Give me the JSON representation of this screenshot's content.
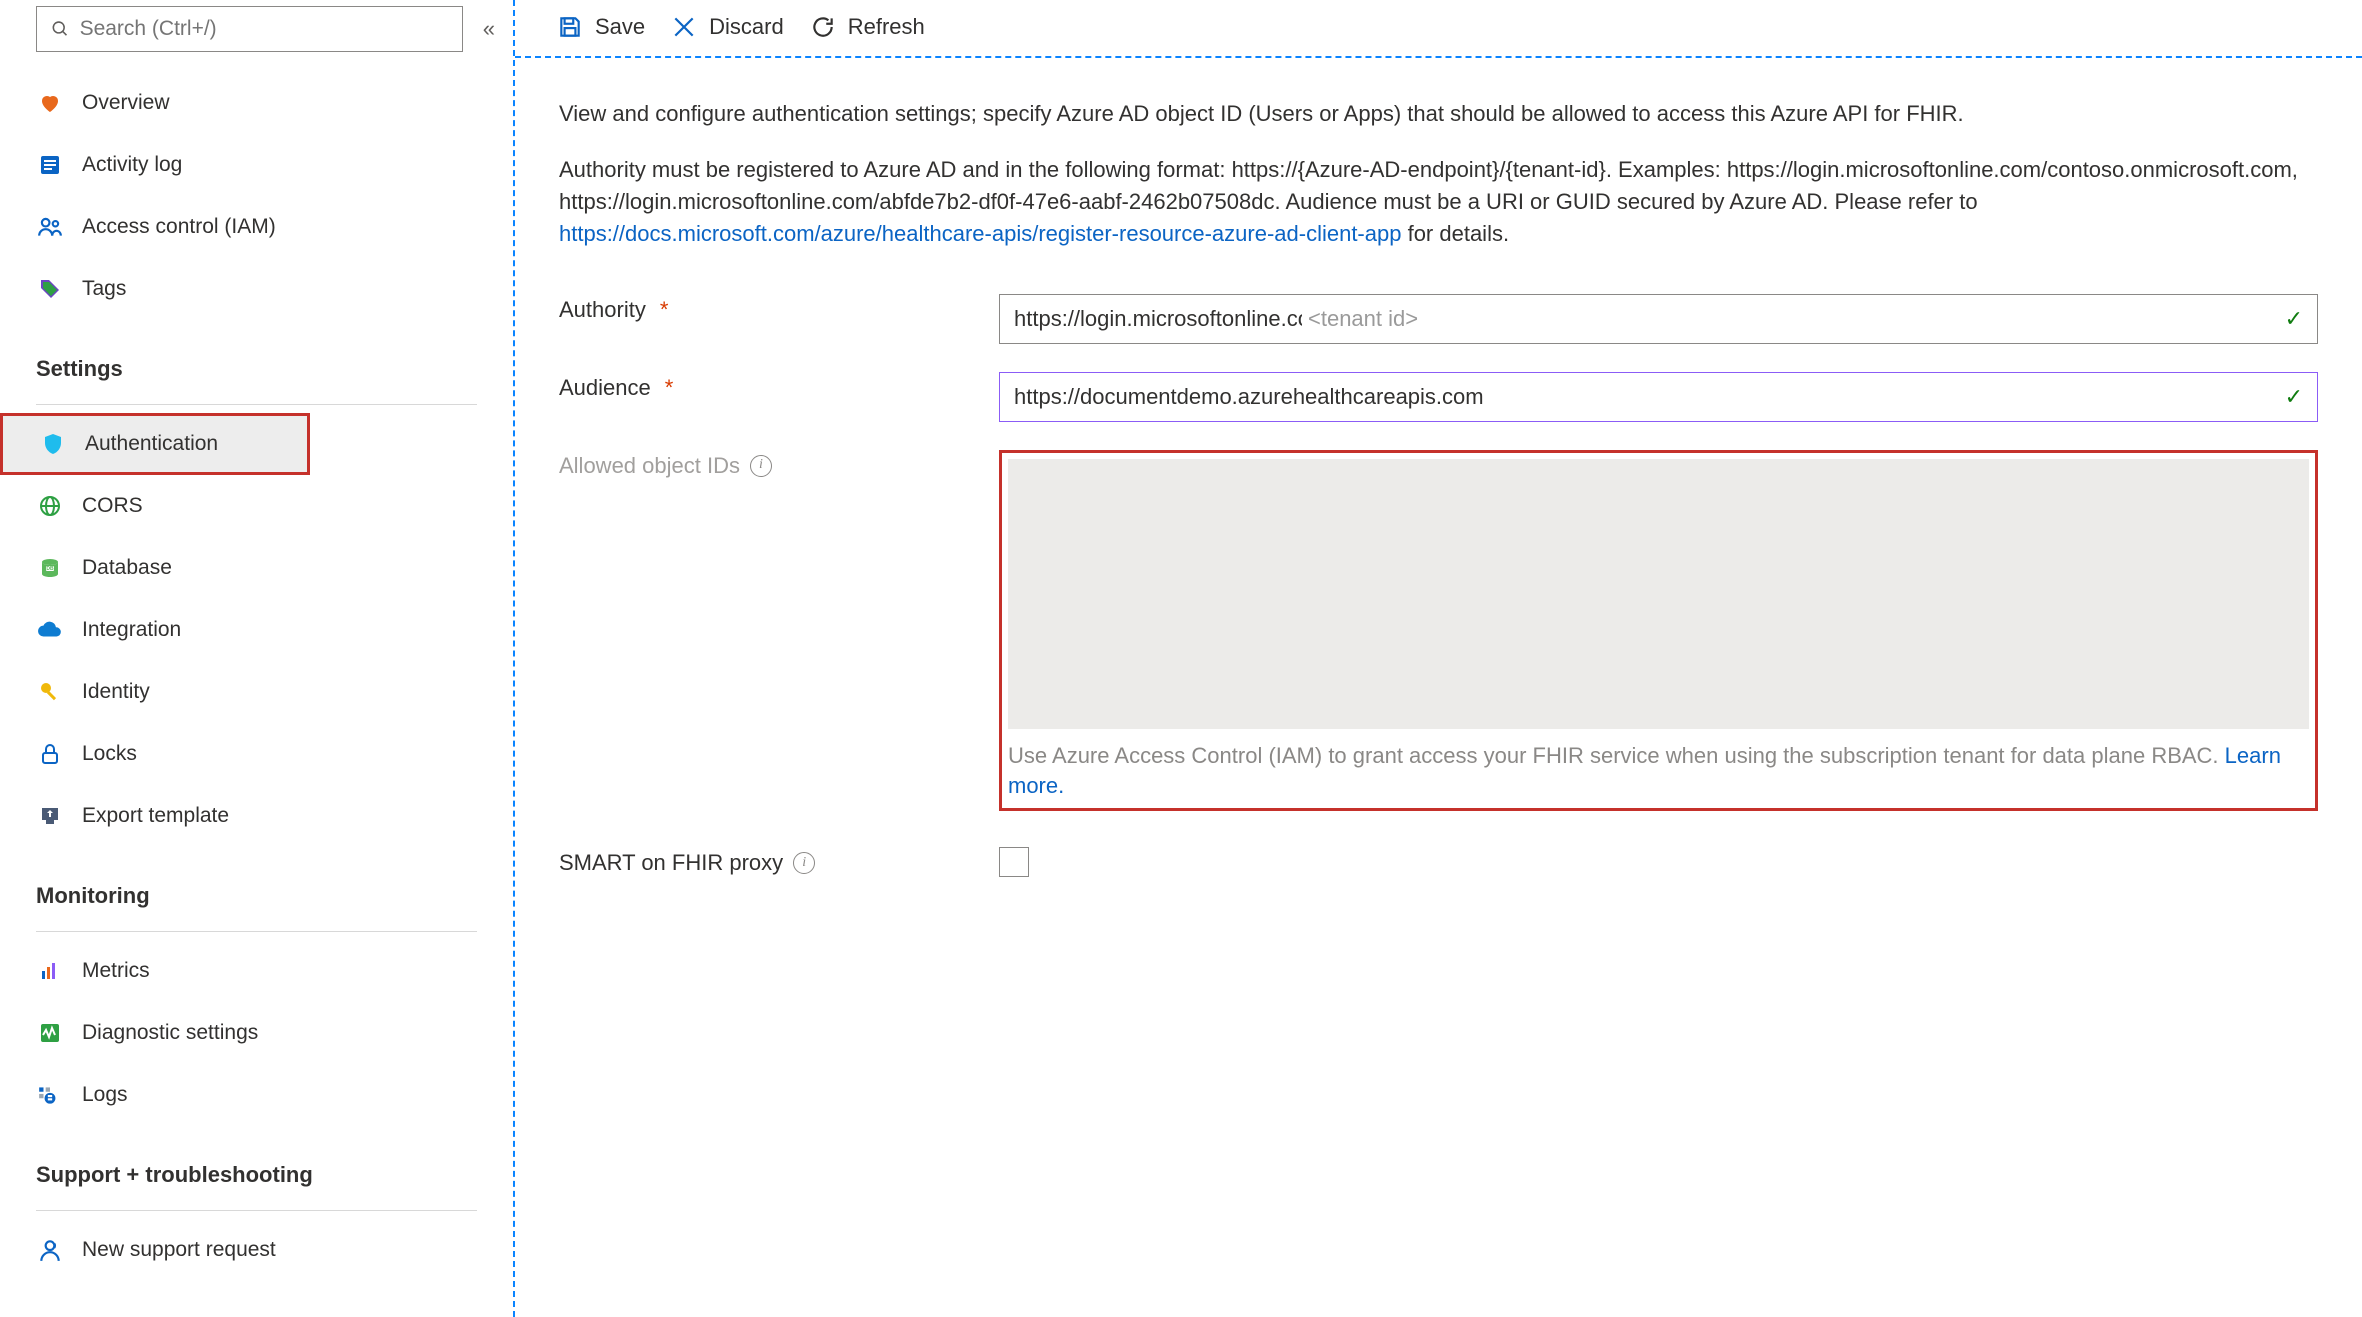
{
  "search": {
    "placeholder": "Search (Ctrl+/)"
  },
  "nav": {
    "overview": "Overview",
    "activity_log": "Activity log",
    "iam": "Access control (IAM)",
    "tags": "Tags"
  },
  "sections": {
    "settings": "Settings",
    "monitoring": "Monitoring",
    "support": "Support + troubleshooting"
  },
  "settings_items": {
    "authentication": "Authentication",
    "cors": "CORS",
    "database": "Database",
    "integration": "Integration",
    "identity": "Identity",
    "locks": "Locks",
    "export_template": "Export template"
  },
  "monitoring_items": {
    "metrics": "Metrics",
    "diagnostic": "Diagnostic settings",
    "logs": "Logs"
  },
  "support_items": {
    "new_request": "New support request"
  },
  "toolbar": {
    "save": "Save",
    "discard": "Discard",
    "refresh": "Refresh"
  },
  "intro": {
    "p1": "View and configure authentication settings; specify Azure AD object ID (Users or Apps) that should be allowed to access this Azure API for FHIR.",
    "p2a": "Authority must be registered to Azure AD and in the following format: https://{Azure-AD-endpoint}/{tenant-id}. Examples: https://login.microsoftonline.com/contoso.onmicrosoft.com, https://login.microsoftonline.com/abfde7b2-df0f-47e6-aabf-2462b07508dc. Audience must be a URI or GUID secured by Azure AD. Please refer to ",
    "p2link": "https://docs.microsoft.com/azure/healthcare-apis/register-resource-azure-ad-client-app",
    "p2b": " for details."
  },
  "form": {
    "authority_label": "Authority",
    "authority_value": "https://login.microsoftonline.com/",
    "authority_hint": "<tenant id>",
    "audience_label": "Audience",
    "audience_value": "https://documentdemo.azurehealthcareapis.com",
    "allowed_label": "Allowed object IDs",
    "allowed_help": "Use Azure Access Control (IAM) to grant access your FHIR service when using the subscription tenant for data plane RBAC. ",
    "allowed_learn": "Learn more.",
    "smart_label": "SMART on FHIR proxy"
  }
}
